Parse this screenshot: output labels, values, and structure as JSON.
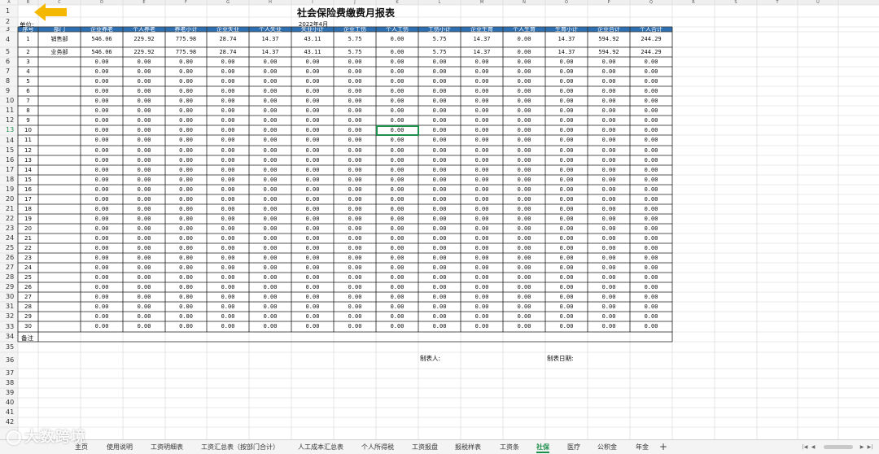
{
  "sheet": {
    "column_letters": [
      "A",
      "B",
      "C",
      "D",
      "E",
      "F",
      "G",
      "H",
      "I",
      "J",
      "K",
      "L",
      "M",
      "N",
      "O",
      "P",
      "Q",
      "R",
      "S",
      "T",
      "U"
    ],
    "title": "社会保险费缴费月报表",
    "subtitle": "2022年4月",
    "unit_label": "单位:",
    "headers": [
      "序号",
      "部门",
      "企业养老",
      "个人养老",
      "养老小计",
      "企业失业",
      "个人失业",
      "失业小计",
      "企业工伤",
      "个人工伤",
      "工伤小计",
      "企业生育",
      "个人生育",
      "生育小计",
      "企业合计",
      "个人合计"
    ],
    "data_rows": [
      {
        "seq": "1",
        "dept": "销售部",
        "values": [
          "546.06",
          "229.92",
          "775.98",
          "28.74",
          "14.37",
          "43.11",
          "5.75",
          "0.00",
          "5.75",
          "14.37",
          "0.00",
          "14.37",
          "594.92",
          "244.29"
        ]
      },
      {
        "seq": "2",
        "dept": "业务部",
        "values": [
          "546.06",
          "229.92",
          "775.98",
          "28.74",
          "14.37",
          "43.11",
          "5.75",
          "0.00",
          "5.75",
          "14.37",
          "0.00",
          "14.37",
          "594.92",
          "244.29"
        ]
      },
      {
        "seq": "3",
        "dept": "",
        "values": [
          "0.00",
          "0.00",
          "0.00",
          "0.00",
          "0.00",
          "0.00",
          "0.00",
          "0.00",
          "0.00",
          "0.00",
          "0.00",
          "0.00",
          "0.00",
          "0.00"
        ]
      },
      {
        "seq": "4",
        "dept": "",
        "values": [
          "0.00",
          "0.00",
          "0.00",
          "0.00",
          "0.00",
          "0.00",
          "0.00",
          "0.00",
          "0.00",
          "0.00",
          "0.00",
          "0.00",
          "0.00",
          "0.00"
        ]
      },
      {
        "seq": "5",
        "dept": "",
        "values": [
          "0.00",
          "0.00",
          "0.00",
          "0.00",
          "0.00",
          "0.00",
          "0.00",
          "0.00",
          "0.00",
          "0.00",
          "0.00",
          "0.00",
          "0.00",
          "0.00"
        ]
      },
      {
        "seq": "6",
        "dept": "",
        "values": [
          "0.00",
          "0.00",
          "0.00",
          "0.00",
          "0.00",
          "0.00",
          "0.00",
          "0.00",
          "0.00",
          "0.00",
          "0.00",
          "0.00",
          "0.00",
          "0.00"
        ]
      },
      {
        "seq": "7",
        "dept": "",
        "values": [
          "0.00",
          "0.00",
          "0.00",
          "0.00",
          "0.00",
          "0.00",
          "0.00",
          "0.00",
          "0.00",
          "0.00",
          "0.00",
          "0.00",
          "0.00",
          "0.00"
        ]
      },
      {
        "seq": "8",
        "dept": "",
        "values": [
          "0.00",
          "0.00",
          "0.00",
          "0.00",
          "0.00",
          "0.00",
          "0.00",
          "0.00",
          "0.00",
          "0.00",
          "0.00",
          "0.00",
          "0.00",
          "0.00"
        ]
      },
      {
        "seq": "9",
        "dept": "",
        "values": [
          "0.00",
          "0.00",
          "0.00",
          "0.00",
          "0.00",
          "0.00",
          "0.00",
          "0.00",
          "0.00",
          "0.00",
          "0.00",
          "0.00",
          "0.00",
          "0.00"
        ]
      },
      {
        "seq": "10",
        "dept": "",
        "values": [
          "0.00",
          "0.00",
          "0.00",
          "0.00",
          "0.00",
          "0.00",
          "0.00",
          "0.00",
          "0.00",
          "0.00",
          "0.00",
          "0.00",
          "0.00",
          "0.00"
        ]
      },
      {
        "seq": "11",
        "dept": "",
        "values": [
          "0.00",
          "0.00",
          "0.00",
          "0.00",
          "0.00",
          "0.00",
          "0.00",
          "0.00",
          "0.00",
          "0.00",
          "0.00",
          "0.00",
          "0.00",
          "0.00"
        ]
      },
      {
        "seq": "12",
        "dept": "",
        "values": [
          "0.00",
          "0.00",
          "0.00",
          "0.00",
          "0.00",
          "0.00",
          "0.00",
          "0.00",
          "0.00",
          "0.00",
          "0.00",
          "0.00",
          "0.00",
          "0.00"
        ]
      },
      {
        "seq": "13",
        "dept": "",
        "values": [
          "0.00",
          "0.00",
          "0.00",
          "0.00",
          "0.00",
          "0.00",
          "0.00",
          "0.00",
          "0.00",
          "0.00",
          "0.00",
          "0.00",
          "0.00",
          "0.00"
        ]
      },
      {
        "seq": "14",
        "dept": "",
        "values": [
          "0.00",
          "0.00",
          "0.00",
          "0.00",
          "0.00",
          "0.00",
          "0.00",
          "0.00",
          "0.00",
          "0.00",
          "0.00",
          "0.00",
          "0.00",
          "0.00"
        ]
      },
      {
        "seq": "15",
        "dept": "",
        "values": [
          "0.00",
          "0.00",
          "0.00",
          "0.00",
          "0.00",
          "0.00",
          "0.00",
          "0.00",
          "0.00",
          "0.00",
          "0.00",
          "0.00",
          "0.00",
          "0.00"
        ]
      },
      {
        "seq": "16",
        "dept": "",
        "values": [
          "0.00",
          "0.00",
          "0.00",
          "0.00",
          "0.00",
          "0.00",
          "0.00",
          "0.00",
          "0.00",
          "0.00",
          "0.00",
          "0.00",
          "0.00",
          "0.00"
        ]
      },
      {
        "seq": "17",
        "dept": "",
        "values": [
          "0.00",
          "0.00",
          "0.00",
          "0.00",
          "0.00",
          "0.00",
          "0.00",
          "0.00",
          "0.00",
          "0.00",
          "0.00",
          "0.00",
          "0.00",
          "0.00"
        ]
      },
      {
        "seq": "18",
        "dept": "",
        "values": [
          "0.00",
          "0.00",
          "0.00",
          "0.00",
          "0.00",
          "0.00",
          "0.00",
          "0.00",
          "0.00",
          "0.00",
          "0.00",
          "0.00",
          "0.00",
          "0.00"
        ]
      },
      {
        "seq": "19",
        "dept": "",
        "values": [
          "0.00",
          "0.00",
          "0.00",
          "0.00",
          "0.00",
          "0.00",
          "0.00",
          "0.00",
          "0.00",
          "0.00",
          "0.00",
          "0.00",
          "0.00",
          "0.00"
        ]
      },
      {
        "seq": "20",
        "dept": "",
        "values": [
          "0.00",
          "0.00",
          "0.00",
          "0.00",
          "0.00",
          "0.00",
          "0.00",
          "0.00",
          "0.00",
          "0.00",
          "0.00",
          "0.00",
          "0.00",
          "0.00"
        ]
      },
      {
        "seq": "21",
        "dept": "",
        "values": [
          "0.00",
          "0.00",
          "0.00",
          "0.00",
          "0.00",
          "0.00",
          "0.00",
          "0.00",
          "0.00",
          "0.00",
          "0.00",
          "0.00",
          "0.00",
          "0.00"
        ]
      },
      {
        "seq": "22",
        "dept": "",
        "values": [
          "0.00",
          "0.00",
          "0.00",
          "0.00",
          "0.00",
          "0.00",
          "0.00",
          "0.00",
          "0.00",
          "0.00",
          "0.00",
          "0.00",
          "0.00",
          "0.00"
        ]
      },
      {
        "seq": "23",
        "dept": "",
        "values": [
          "0.00",
          "0.00",
          "0.00",
          "0.00",
          "0.00",
          "0.00",
          "0.00",
          "0.00",
          "0.00",
          "0.00",
          "0.00",
          "0.00",
          "0.00",
          "0.00"
        ]
      },
      {
        "seq": "24",
        "dept": "",
        "values": [
          "0.00",
          "0.00",
          "0.00",
          "0.00",
          "0.00",
          "0.00",
          "0.00",
          "0.00",
          "0.00",
          "0.00",
          "0.00",
          "0.00",
          "0.00",
          "0.00"
        ]
      },
      {
        "seq": "25",
        "dept": "",
        "values": [
          "0.00",
          "0.00",
          "0.00",
          "0.00",
          "0.00",
          "0.00",
          "0.00",
          "0.00",
          "0.00",
          "0.00",
          "0.00",
          "0.00",
          "0.00",
          "0.00"
        ]
      },
      {
        "seq": "26",
        "dept": "",
        "values": [
          "0.00",
          "0.00",
          "0.00",
          "0.00",
          "0.00",
          "0.00",
          "0.00",
          "0.00",
          "0.00",
          "0.00",
          "0.00",
          "0.00",
          "0.00",
          "0.00"
        ]
      },
      {
        "seq": "27",
        "dept": "",
        "values": [
          "0.00",
          "0.00",
          "0.00",
          "0.00",
          "0.00",
          "0.00",
          "0.00",
          "0.00",
          "0.00",
          "0.00",
          "0.00",
          "0.00",
          "0.00",
          "0.00"
        ]
      },
      {
        "seq": "28",
        "dept": "",
        "values": [
          "0.00",
          "0.00",
          "0.00",
          "0.00",
          "0.00",
          "0.00",
          "0.00",
          "0.00",
          "0.00",
          "0.00",
          "0.00",
          "0.00",
          "0.00",
          "0.00"
        ]
      },
      {
        "seq": "29",
        "dept": "",
        "values": [
          "0.00",
          "0.00",
          "0.00",
          "0.00",
          "0.00",
          "0.00",
          "0.00",
          "0.00",
          "0.00",
          "0.00",
          "0.00",
          "0.00",
          "0.00",
          "0.00"
        ]
      },
      {
        "seq": "30",
        "dept": "",
        "values": [
          "0.00",
          "0.00",
          "0.00",
          "0.00",
          "0.00",
          "0.00",
          "0.00",
          "0.00",
          "0.00",
          "0.00",
          "0.00",
          "0.00",
          "0.00",
          "0.00"
        ]
      }
    ],
    "remark_label": "备注",
    "preparer_label": "制表人:",
    "prep_date_label": "制表日期:",
    "row_numbers": [
      "1",
      "2",
      "3",
      "4",
      "5",
      "6",
      "7",
      "8",
      "9",
      "10",
      "11",
      "12",
      "13",
      "14",
      "15",
      "16",
      "17",
      "18",
      "19",
      "20",
      "21",
      "22",
      "23",
      "24",
      "25",
      "26",
      "27",
      "28",
      "29",
      "30",
      "31",
      "32",
      "33",
      "34",
      "35",
      "36",
      "37",
      "38",
      "39",
      "40",
      "41",
      "42"
    ],
    "selected_cell": "J13"
  },
  "tabs": [
    {
      "label": "主页",
      "active": false
    },
    {
      "label": "使用说明",
      "active": false
    },
    {
      "label": "工资明细表",
      "active": false
    },
    {
      "label": "工资汇总表（按部门合计）",
      "active": false
    },
    {
      "label": "人工成本汇总表",
      "active": false
    },
    {
      "label": "个人所得税",
      "active": false
    },
    {
      "label": "工资报盘",
      "active": false
    },
    {
      "label": "报税样表",
      "active": false
    },
    {
      "label": "工资条",
      "active": false
    },
    {
      "label": "社保",
      "active": true
    },
    {
      "label": "医疗",
      "active": false
    },
    {
      "label": "公积金",
      "active": false
    },
    {
      "label": "年金",
      "active": false
    }
  ],
  "add_tab_label": "+",
  "watermark_text": "大数跨境",
  "colors": {
    "header_fill": "#2d6fb3",
    "grid_line": "#d4d4d4",
    "table_border": "#222222",
    "selection": "#1e8f4c",
    "arrow": "#f5b800"
  }
}
